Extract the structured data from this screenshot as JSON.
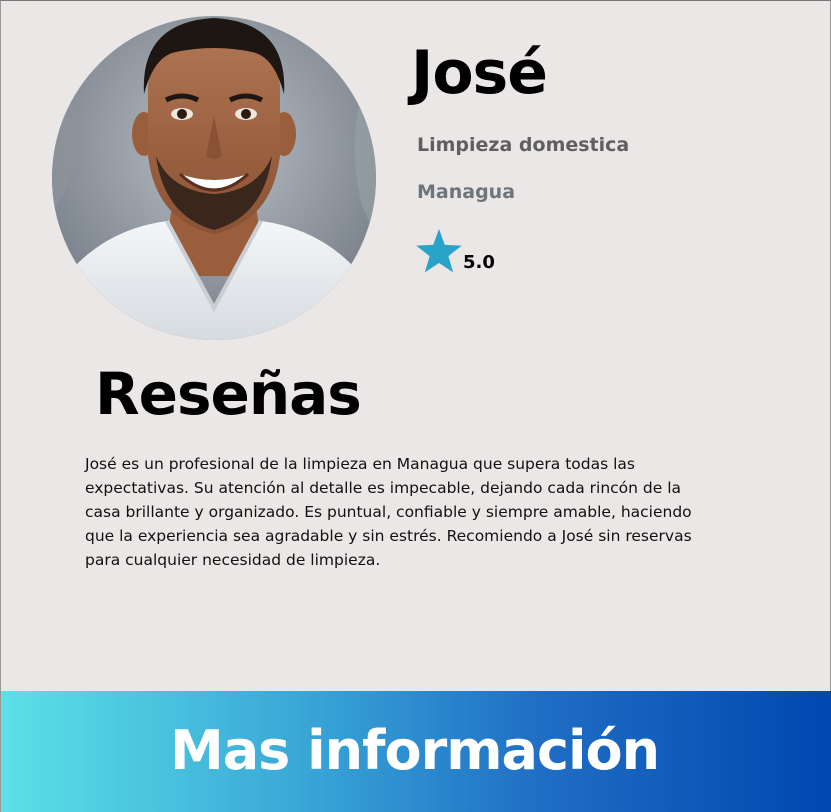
{
  "profile": {
    "name": "José",
    "service": "Limpieza domestica",
    "city": "Managua",
    "rating": "5.0",
    "photo": "portrait-photo"
  },
  "reviews": {
    "title": "Reseñas",
    "text": "José es un profesional de la limpieza en Managua que supera todas las expectativas. Su atención al detalle es impecable, dejando cada rincón de la casa brillante y organizado. Es puntual, confiable y siempre amable, haciendo que la experiencia sea agradable y sin estrés. Recomiendo a José sin reservas para cualquier necesidad de limpieza."
  },
  "footer": {
    "button_label": "Mas información"
  },
  "colors": {
    "background": "#ebe7e6",
    "star": "#2aa3c9",
    "gradient_start": "#5ce1e6",
    "gradient_end": "#0047b0"
  },
  "icons": {
    "rating": "star-icon"
  }
}
